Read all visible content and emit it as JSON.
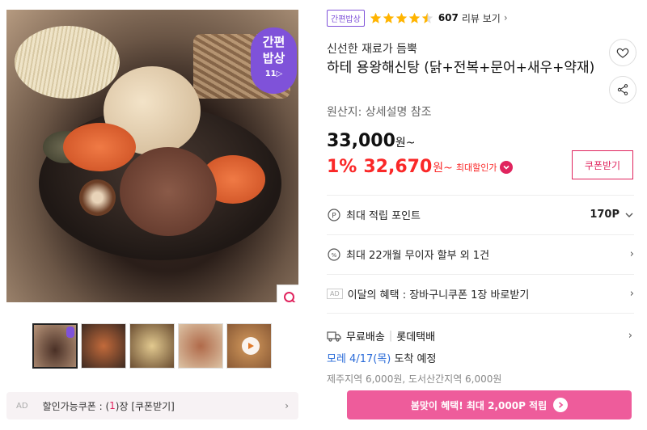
{
  "gallery": {
    "badge": {
      "line1": "간편",
      "line2": "밥상",
      "line3": "11▷"
    },
    "thumbnails": [
      "thumb-1",
      "thumb-2",
      "thumb-3",
      "thumb-4",
      "thumb-5-video"
    ],
    "coupon_bar": {
      "ad": "AD",
      "prefix": "할인가능쿠폰 : (",
      "count": "1",
      "suffix": ")장 [쿠폰받기]"
    }
  },
  "product": {
    "tag": "간편밥상",
    "rating": 4.5,
    "review_count": "607",
    "review_link": "리뷰 보기",
    "brand": "신선한 재료가 듬뿍",
    "title": "하테 용왕해신탕 (닭+전복+문어+새우+약재)",
    "origin": "원산지:  상세설명 참조",
    "price": "33,000",
    "price_unit": "원~",
    "discount_pct": "1%",
    "sale_price": "32,670",
    "sale_unit": "원~",
    "best_label": "최대할인가",
    "coupon_button": "쿠폰받기"
  },
  "benefits": {
    "points_label": "최대 적립 포인트",
    "points_value": "170P",
    "installment": "최대 22개월 무이자 할부 외 1건",
    "monthly_ad": "AD",
    "monthly_benefit": "이달의 혜택 : 장바구니쿠폰 1장 바로받기"
  },
  "shipping": {
    "free": "무료배송",
    "carrier": "롯데택배",
    "arrival_prefix": "모레 4/17(목)",
    "arrival_suffix": " 도착 예정",
    "extra": "제주지역 6,000원, 도서산간지역 6,000원"
  },
  "cta": {
    "label": "봄맞이 혜택! 최대 2,000P 적립"
  },
  "colors": {
    "accent": "#e0245e",
    "sale": "#fa2828",
    "purple": "#7f52d9",
    "cta": "#ee5c9b",
    "blue": "#2a6bd9"
  }
}
